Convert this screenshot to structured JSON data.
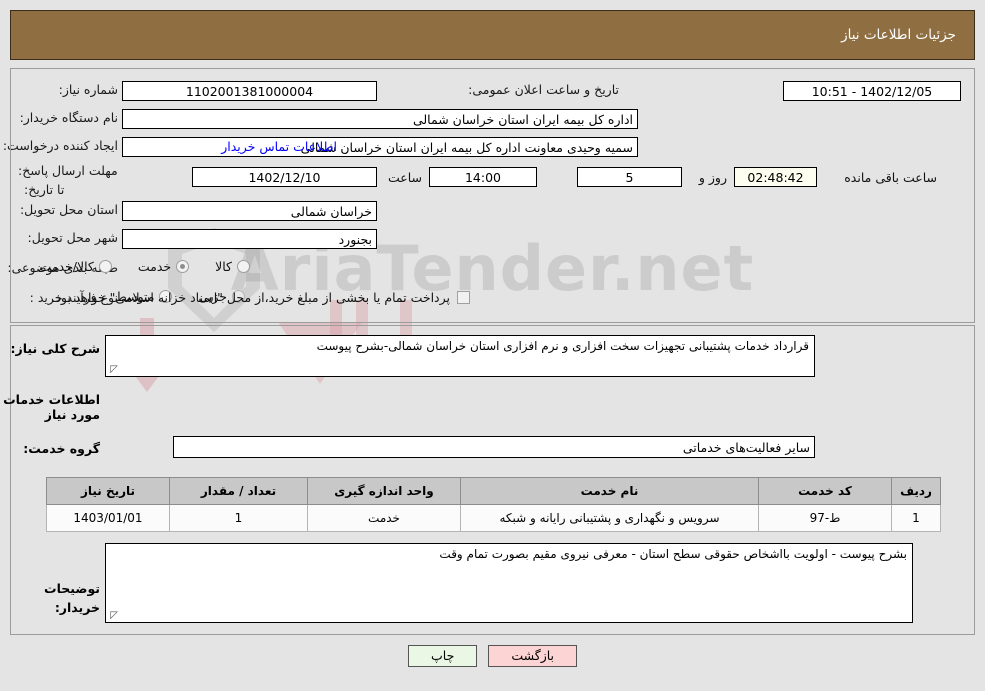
{
  "header": {
    "title": "جزئیات اطلاعات نیاز",
    "bg_color": "#8f6e42",
    "text_color": "#ffffff"
  },
  "watermark": {
    "text": "AriaTender.net"
  },
  "info": {
    "need_number": {
      "label": "شماره نیاز:",
      "value": "1102001381000004"
    },
    "announce_datetime": {
      "label": "تاریخ و ساعت اعلان عمومی:",
      "value": "10:51 - 1402/12/05"
    },
    "buyer_org": {
      "label": "نام دستگاه خریدار:",
      "value": "اداره کل بیمه ایران استان خراسان شمالی"
    },
    "request_creator": {
      "label": "ایجاد کننده درخواست:",
      "value": "سمیه وحیدی معاونت اداره کل بیمه ایران استان خراسان شمالی"
    },
    "buyer_contact_link": "اطلاعات تماس خریدار",
    "response_deadline": {
      "label": "مهلت ارسال پاسخ: تا تاریخ:",
      "date": "1402/12/10",
      "hour_label": "ساعت",
      "hour": "14:00",
      "days": "5",
      "days_suffix": "روز و",
      "countdown": "02:48:42",
      "countdown_suffix": "ساعت باقی مانده"
    },
    "delivery_province": {
      "label": "استان محل تحویل:",
      "value": "خراسان شمالی"
    },
    "delivery_city": {
      "label": "شهر محل تحویل:",
      "value": "بجنورد"
    },
    "subject_category": {
      "label": "طبقه بندی موضوعی:",
      "options": [
        {
          "label": "کالا",
          "selected": false
        },
        {
          "label": "خدمت",
          "selected": true
        },
        {
          "label": "کالا/خدمت",
          "selected": false
        }
      ]
    },
    "purchase_process": {
      "label": "نوع فرآیند خرید :",
      "options": [
        {
          "label": "جزیی",
          "selected": false
        },
        {
          "label": "متوسط",
          "selected": false
        }
      ],
      "treasury_checkbox": {
        "checked": false,
        "label": "پرداخت تمام یا بخشی از مبلغ خرید،از محل \"اسناد خزانه اسلامی\" خواهد بود."
      }
    }
  },
  "need_summary": {
    "label": "شرح کلی نیاز:",
    "value": "قرارداد خدمات پشتیبانی تجهیزات سخت افزاری و نرم افزاری استان خراسان شمالی-بشرح پیوست"
  },
  "services_section": {
    "heading": "اطلاعات خدمات مورد نیاز",
    "service_group": {
      "label": "گروه خدمت:",
      "value": "سایر فعالیت‌های خدماتی"
    },
    "table": {
      "columns": [
        "ردیف",
        "کد خدمت",
        "نام خدمت",
        "واحد اندازه گیری",
        "تعداد / مقدار",
        "تاریخ نیاز"
      ],
      "rows": [
        {
          "row_no": "1",
          "service_code": "ط-97",
          "service_name": "سرویس و نگهداری و پشتیبانی رایانه و شبکه",
          "unit": "خدمت",
          "quantity": "1",
          "need_date": "1403/01/01"
        }
      ]
    }
  },
  "buyer_notes": {
    "label": "توضیحات خریدار:",
    "value": "بشرح پیوست - اولویت بااشخاص حقوقی سطح استان - معرفی نیروی مقیم بصورت تمام وقت"
  },
  "footer": {
    "print_button": "چاپ",
    "back_button": "بازگشت"
  }
}
